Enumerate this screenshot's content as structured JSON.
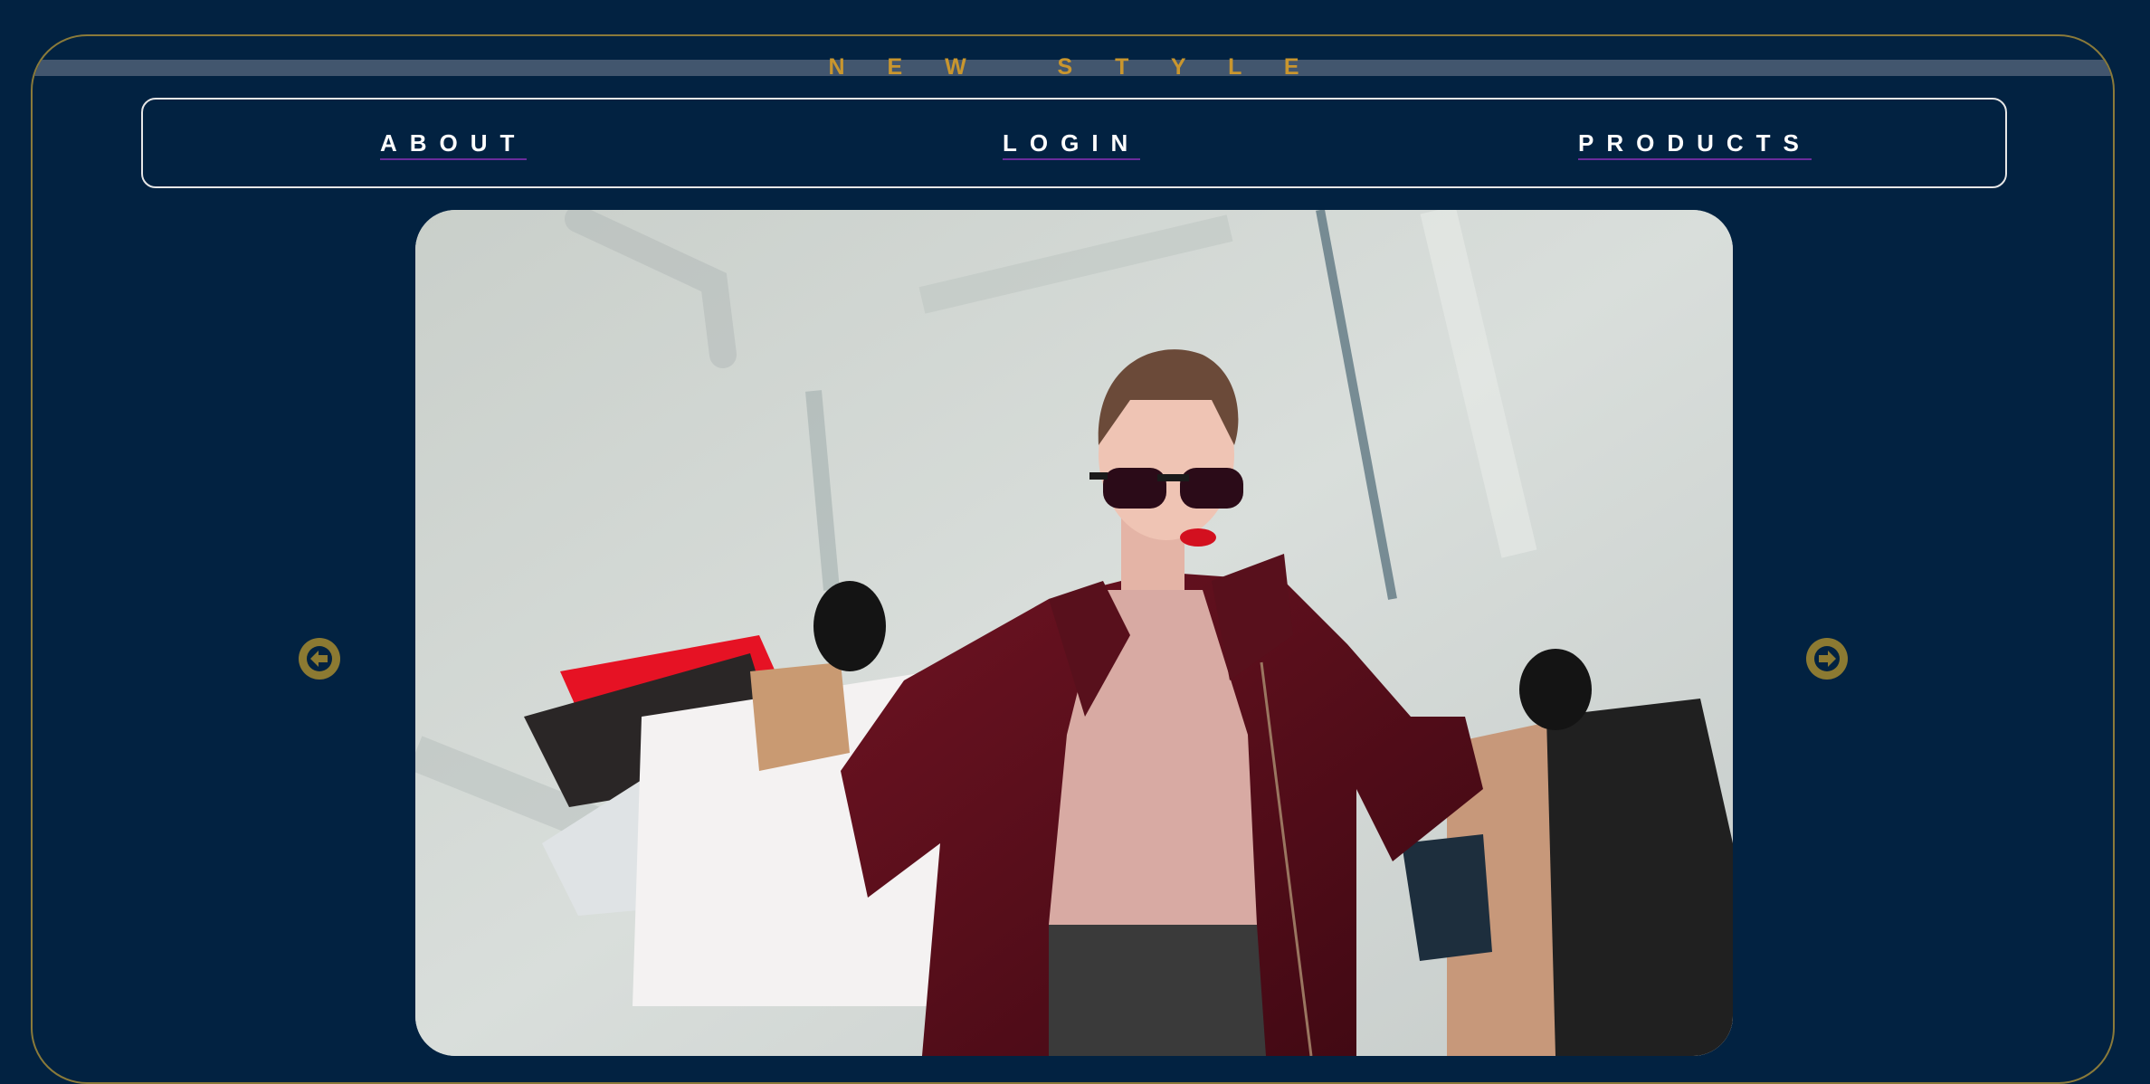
{
  "header": {
    "brand_title": "N E W   S T Y L E"
  },
  "nav": {
    "items": [
      {
        "label": "ABOUT"
      },
      {
        "label": "LOGIN"
      },
      {
        "label": "PRODUCTS"
      }
    ]
  },
  "carousel": {
    "prev_icon": "arrow-left-circle-icon",
    "next_icon": "arrow-right-circle-icon",
    "image_description_icon": "fashion-photo"
  },
  "colors": {
    "background": "#022241",
    "frame_border": "#8a7a3a",
    "brand_text": "#c9962e",
    "top_bar": "#42566e",
    "nav_border": "#e6e6e6",
    "nav_text": "#ffffff",
    "nav_underline": "#6a2c9c",
    "arrow_button": "#8c7a32"
  }
}
